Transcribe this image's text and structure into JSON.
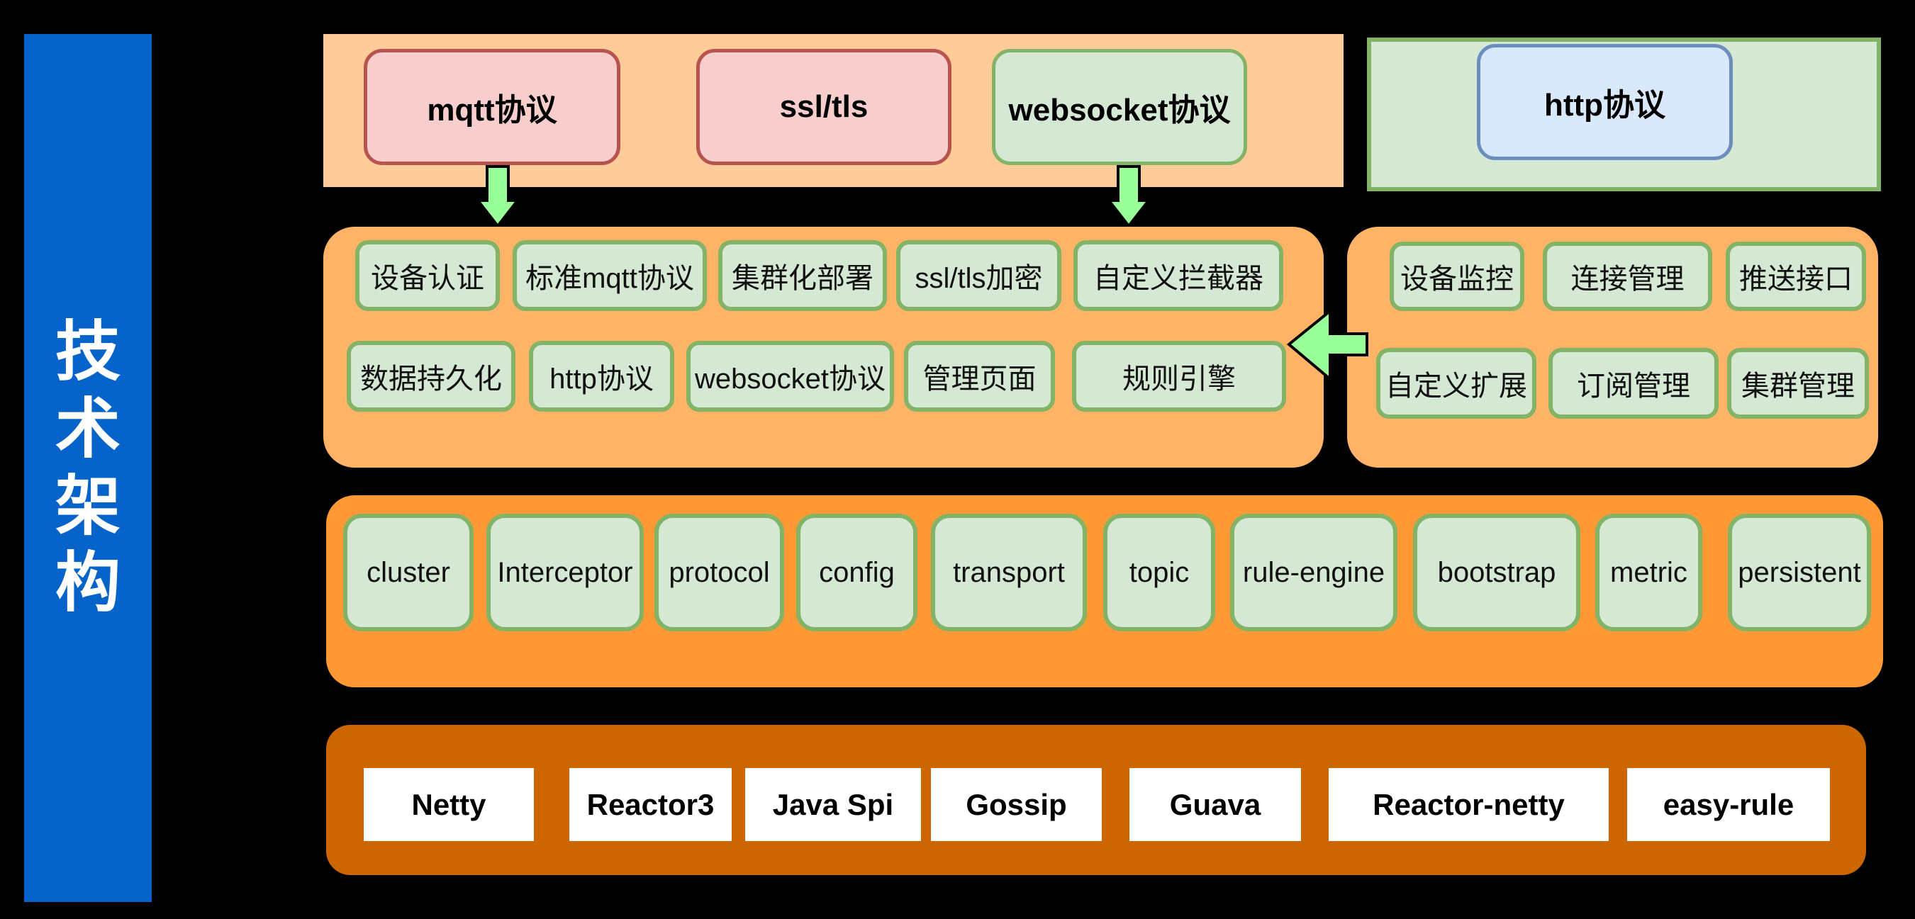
{
  "sidebar": {
    "title_chars": [
      "技",
      "术",
      "架",
      "构"
    ],
    "title": "技术架构"
  },
  "access_layer": {
    "protocols": [
      {
        "label": "mqtt协议",
        "style": "red"
      },
      {
        "label": "ssl/tls",
        "style": "red"
      },
      {
        "label": "websocket协议",
        "style": "green"
      }
    ],
    "http": {
      "label": "http协议",
      "style": "blue"
    }
  },
  "feature_layer": {
    "broker_row1": [
      "设备认证",
      "标准mqtt协议",
      "集群化部署",
      "ssl/tls加密",
      "自定义拦截器"
    ],
    "broker_row2": [
      "数据持久化",
      "http协议",
      "websocket协议",
      "管理页面",
      "规则引擎"
    ],
    "admin_row1": [
      "设备监控",
      "连接管理",
      "推送接口"
    ],
    "admin_row2": [
      "自定义扩展",
      "订阅管理",
      "集群管理"
    ]
  },
  "module_layer": {
    "modules": [
      "cluster",
      "Interceptor",
      "protocol",
      "config",
      "transport",
      "topic",
      "rule-engine",
      "bootstrap",
      "metric",
      "persistent"
    ]
  },
  "foundation_layer": {
    "libraries": [
      "Netty",
      "Reactor3",
      "Java Spi",
      "Gossip",
      "Guava",
      "Reactor-netty",
      "easy-rule"
    ]
  },
  "colors": {
    "sidebar": "#0563C9",
    "access_band": "#FFCC99",
    "http_band": "#D5E8D4",
    "feature_panel": "#FFB366",
    "module_panel": "#FF9933",
    "foundation_panel": "#CC6600",
    "arrow": "#99FF99"
  }
}
